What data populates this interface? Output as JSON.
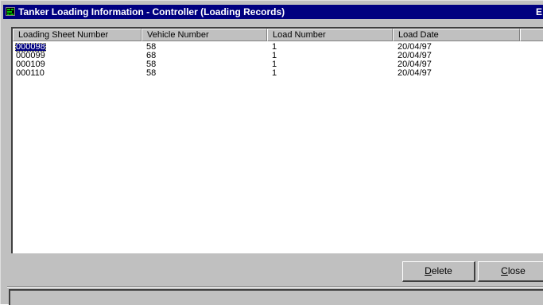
{
  "window": {
    "title": "Tanker Loading Information - Controller (Loading Records)",
    "title_clipped_char": "E",
    "colors": {
      "titlebar": "#000080",
      "face": "#c0c0c0",
      "selection": "#000080"
    }
  },
  "list": {
    "columns": [
      "Loading Sheet Number",
      "Vehicle Number",
      "Load Number",
      "Load Date",
      ""
    ],
    "rows": [
      {
        "sheet": "000098",
        "vehicle": "58",
        "load": "1",
        "date": "20/04/97",
        "selected": true
      },
      {
        "sheet": "000099",
        "vehicle": "68",
        "load": "1",
        "date": "20/04/97"
      },
      {
        "sheet": "000109",
        "vehicle": "58",
        "load": "1",
        "date": "20/04/97"
      },
      {
        "sheet": "000110",
        "vehicle": "58",
        "load": "1",
        "date": "20/04/97"
      }
    ]
  },
  "buttons": {
    "delete": {
      "pre": "",
      "hot": "D",
      "post": "elete"
    },
    "close": {
      "pre": "",
      "hot": "C",
      "post": "lose"
    }
  },
  "status": {
    "text": ""
  }
}
